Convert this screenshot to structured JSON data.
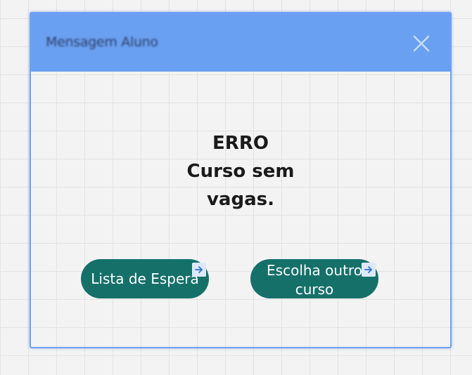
{
  "dialog": {
    "title": "Mensagem Aluno",
    "close_icon": "close-icon",
    "message": {
      "line1": "ERRO",
      "line2": "Curso sem",
      "line3": "vagas."
    },
    "buttons": {
      "wait_list_label": "Lista de Espera",
      "other_course_line1": "Escolha outro",
      "other_course_line2": "curso",
      "link_icon": "link-arrow-icon"
    }
  },
  "colors": {
    "titlebar": "#6aa0f2",
    "dialog_border": "#6ea1f2",
    "button_bg": "#15706a",
    "button_text": "#ffffff",
    "message_text": "#1a1a1a",
    "canvas_bg": "#f3f3f3"
  }
}
